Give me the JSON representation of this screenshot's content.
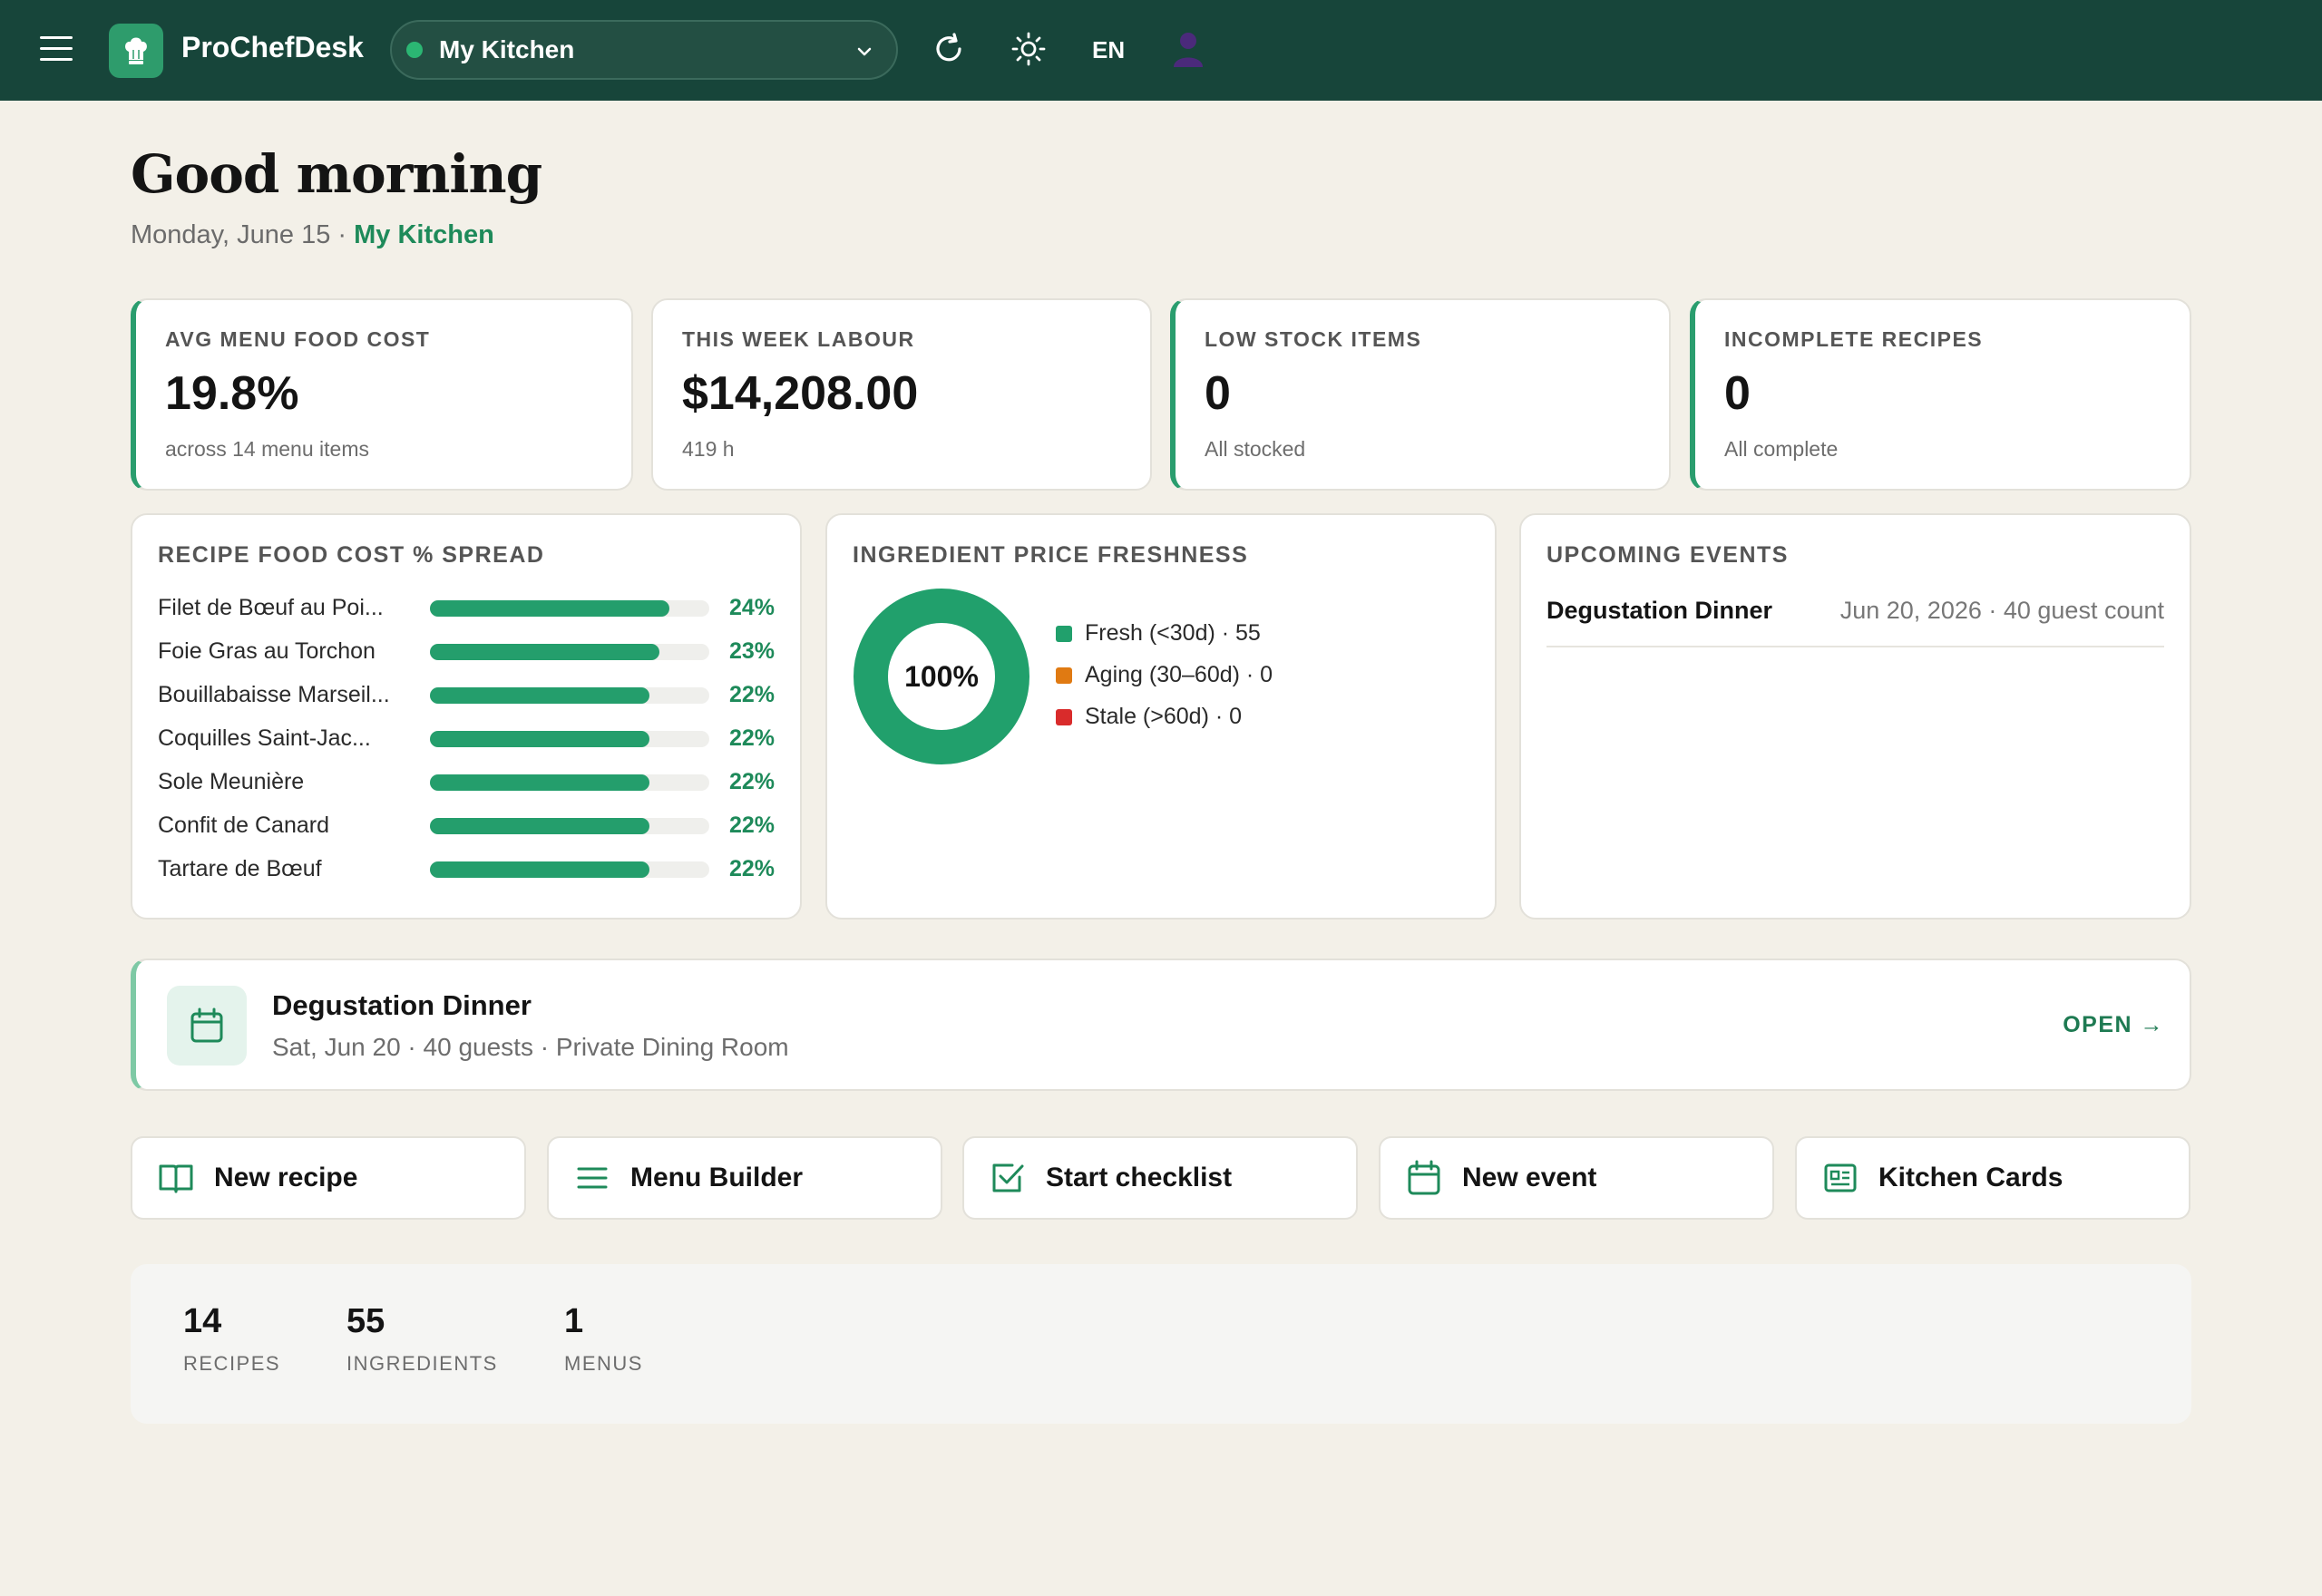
{
  "app": {
    "name": "ProChefDesk",
    "kitchen": "My Kitchen",
    "language": "EN"
  },
  "greeting": {
    "title": "Good morning",
    "date": "Monday, June 15 · ",
    "kitchen": "My Kitchen"
  },
  "kpis": [
    {
      "title": "AVG MENU FOOD COST",
      "value": "19.8%",
      "sub": "across 14 menu items"
    },
    {
      "title": "THIS WEEK LABOUR",
      "value": "$14,208.00",
      "sub": "419 h"
    },
    {
      "title": "LOW STOCK ITEMS",
      "value": "0",
      "sub": "All stocked"
    },
    {
      "title": "INCOMPLETE RECIPES",
      "value": "0",
      "sub": "All complete"
    }
  ],
  "spread": {
    "title": "RECIPE FOOD COST % SPREAD",
    "rows": [
      {
        "name": "Filet de Bœuf au Poi...",
        "pct_label": "24%",
        "value": 24
      },
      {
        "name": "Foie Gras au Torchon",
        "pct_label": "23%",
        "value": 23
      },
      {
        "name": "Bouillabaisse Marseil...",
        "pct_label": "22%",
        "value": 22
      },
      {
        "name": "Coquilles Saint-Jac...",
        "pct_label": "22%",
        "value": 22
      },
      {
        "name": "Sole Meunière",
        "pct_label": "22%",
        "value": 22
      },
      {
        "name": "Confit de Canard",
        "pct_label": "22%",
        "value": 22
      },
      {
        "name": "Tartare de Bœuf",
        "pct_label": "22%",
        "value": 22
      }
    ],
    "max": 28
  },
  "freshness": {
    "title": "INGREDIENT PRICE FRESHNESS",
    "center_label": "100%",
    "legend": [
      {
        "label": "Fresh (<30d) · 55",
        "color": "#21a06c",
        "count": 55
      },
      {
        "label": "Aging (30–60d) · 0",
        "color": "#e07a12",
        "count": 0
      },
      {
        "label": "Stale (>60d) · 0",
        "color": "#d92b2b",
        "count": 0
      }
    ]
  },
  "events": {
    "title": "UPCOMING EVENTS",
    "items": [
      {
        "name": "Degustation Dinner",
        "meta": "Jun 20, 2026 · 40 guest count"
      }
    ]
  },
  "banner": {
    "title": "Degustation Dinner",
    "sub": "Sat, Jun 20 · 40 guests · Private Dining Room",
    "open_label": "OPEN →"
  },
  "actions": [
    {
      "label": "New recipe",
      "icon": "book-icon"
    },
    {
      "label": "Menu Builder",
      "icon": "list-icon"
    },
    {
      "label": "Start checklist",
      "icon": "checkbox-icon"
    },
    {
      "label": "New event",
      "icon": "calendar-icon"
    },
    {
      "label": "Kitchen Cards",
      "icon": "id-card-icon"
    }
  ],
  "stats": [
    {
      "value": "14",
      "label": "RECIPES"
    },
    {
      "value": "55",
      "label": "INGREDIENTS"
    },
    {
      "value": "1",
      "label": "MENUS"
    }
  ],
  "colors": {
    "topbar": "#17453a",
    "accent": "#249e6c",
    "background": "#f3f0e8"
  }
}
